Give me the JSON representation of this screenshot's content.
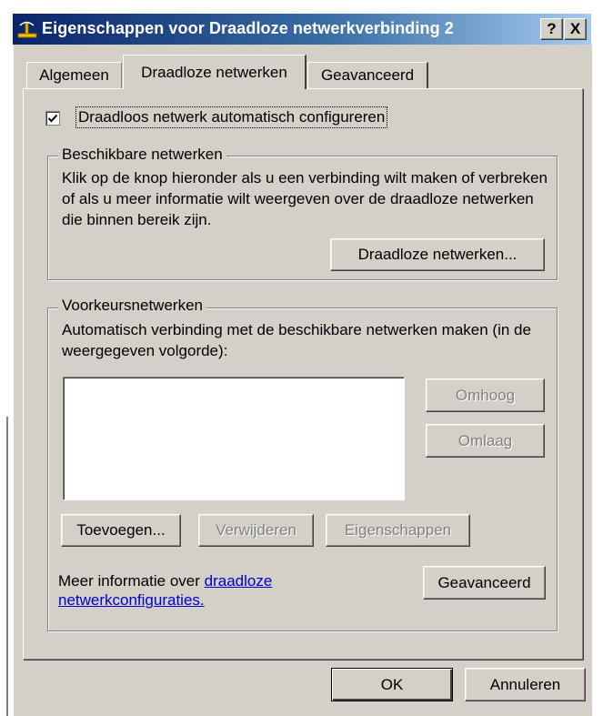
{
  "window": {
    "title": "Eigenschappen voor Draadloze netwerkverbinding 2",
    "help_label": "?",
    "close_label": "X"
  },
  "tabs": [
    {
      "label": "Algemeen"
    },
    {
      "label": "Draadloze netwerken"
    },
    {
      "label": "Geavanceerd"
    }
  ],
  "auto_config": {
    "label": "Draadloos netwerk automatisch configureren",
    "checked": true
  },
  "available_networks": {
    "legend": "Beschikbare netwerken",
    "description": "Klik op de knop hieronder als u een verbinding wilt maken of verbreken of als u meer informatie wilt weergeven over de draadloze netwerken die binnen bereik zijn.",
    "button_label": "Draadloze netwerken..."
  },
  "preferred_networks": {
    "legend": "Voorkeursnetwerken",
    "description": "Automatisch verbinding met de beschikbare netwerken maken (in de weergegeven volgorde):",
    "items": [],
    "up_label": "Omhoog",
    "down_label": "Omlaag",
    "add_label": "Toevoegen...",
    "remove_label": "Verwijderen",
    "properties_label": "Eigenschappen"
  },
  "more_info": {
    "prefix": "Meer informatie over ",
    "link_text_1": "draadloze",
    "link_text_2": "netwerkconfiguraties."
  },
  "advanced_button_label": "Geavanceerd",
  "footer": {
    "ok_label": "OK",
    "cancel_label": "Annuleren"
  }
}
